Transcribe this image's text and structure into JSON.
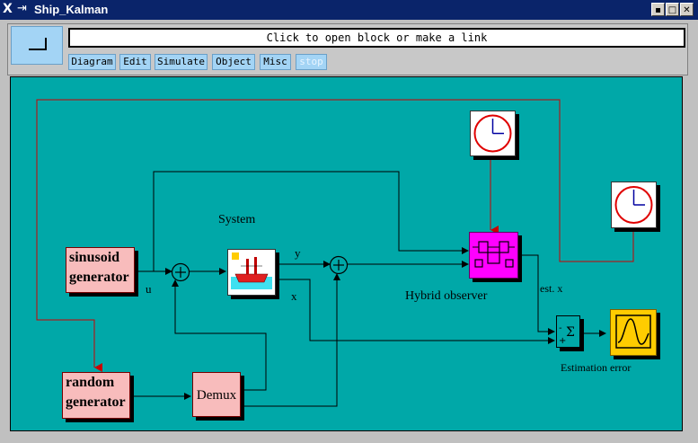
{
  "window": {
    "title": "Ship_Kalman"
  },
  "toolbar": {
    "message": "Click to open block or make a link"
  },
  "menu": [
    {
      "label": "Diagram"
    },
    {
      "label": "Edit"
    },
    {
      "label": "Simulate"
    },
    {
      "label": "Object"
    },
    {
      "label": "Misc"
    },
    {
      "label": "stop",
      "disabled": true
    }
  ],
  "diagram": {
    "blocks": {
      "sinusoid": "sinusoid generator",
      "sinusoid_l1": "sinusoid",
      "sinusoid_l2": "generator",
      "random_l1": "random",
      "random_l2": "generator",
      "demux": "Demux"
    },
    "labels": {
      "system": "System",
      "u": "u",
      "y": "y",
      "x": "x",
      "hybrid_observer": "Hybrid observer",
      "est_x": "est. x",
      "estimation_error": "Estimation error"
    },
    "colors": {
      "canvas": "#00a8a8",
      "block_fill": "#f8bcbc",
      "observer_fill": "#ff00ff",
      "scope_fill": "#ffcc00",
      "activation_link": "#cc0000"
    },
    "icons": [
      "clock-icon",
      "ship-icon",
      "scope-icon",
      "sum-icon",
      "observer-icon"
    ]
  }
}
